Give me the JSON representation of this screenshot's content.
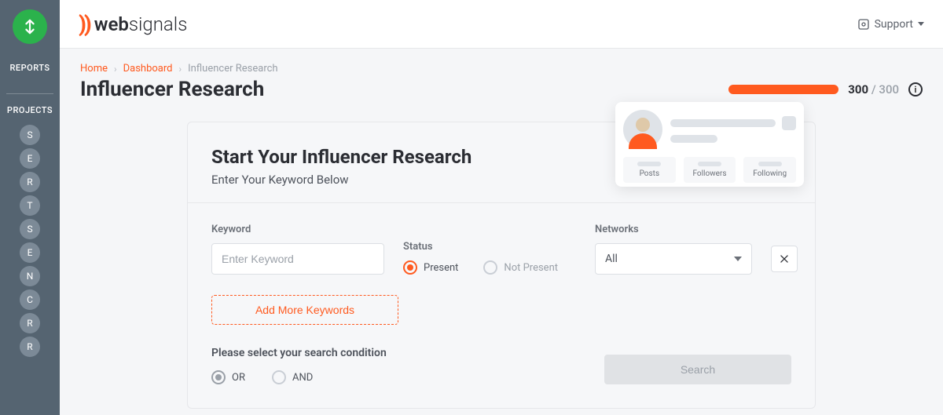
{
  "sidebar": {
    "sections": {
      "reports_label": "REPORTS",
      "projects_label": "PROJECTS"
    },
    "projects": [
      "S",
      "E",
      "R",
      "T",
      "S",
      "E",
      "N",
      "C",
      "R",
      "R"
    ]
  },
  "brand": {
    "name_strong": "web",
    "name_light": "signals"
  },
  "topbar": {
    "support_label": "Support"
  },
  "breadcrumb": {
    "home": "Home",
    "dashboard": "Dashboard",
    "current": "Influencer Research"
  },
  "page": {
    "title": "Influencer Research"
  },
  "usage": {
    "used": "300",
    "total": "300"
  },
  "card": {
    "title": "Start Your Influencer Research",
    "subtitle": "Enter Your Keyword Below"
  },
  "profile_widget": {
    "stats": [
      "Posts",
      "Followers",
      "Following"
    ]
  },
  "form": {
    "keyword_label": "Keyword",
    "keyword_placeholder": "Enter Keyword",
    "status_label": "Status",
    "status_present": "Present",
    "status_not_present": "Not Present",
    "networks_label": "Networks",
    "networks_value": "All",
    "add_more_label": "Add More Keywords",
    "condition_label": "Please select your search condition",
    "condition_or": "OR",
    "condition_and": "AND",
    "search_label": "Search"
  }
}
